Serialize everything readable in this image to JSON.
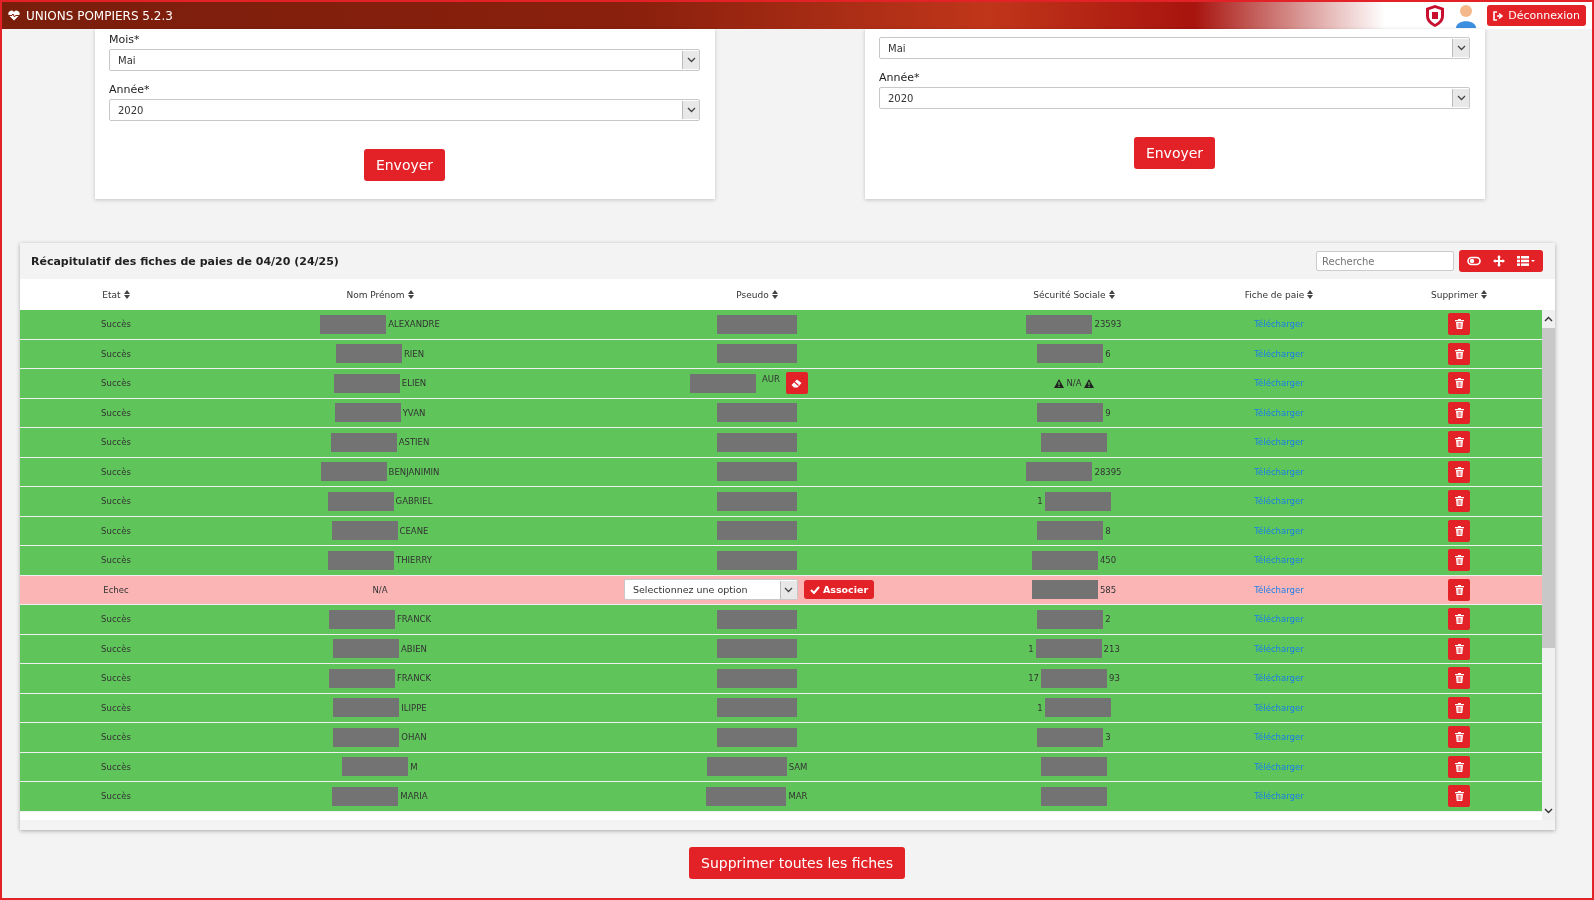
{
  "app": {
    "title": "UNIONS POMPIERS 5.2.3",
    "logout": "Déconnexion"
  },
  "forms": [
    {
      "fields": [
        {
          "label": "Mois*",
          "value": "Mai"
        },
        {
          "label": "Année*",
          "value": "2020"
        }
      ],
      "submit": "Envoyer"
    },
    {
      "fields": [
        {
          "value": "Mai"
        },
        {
          "label": "Année*",
          "value": "2020"
        }
      ],
      "submit": "Envoyer"
    }
  ],
  "summary": {
    "title": "Récapitulatif des fiches de paies de 04/20 (24/25)",
    "search": {
      "placeholder": "Recherche"
    },
    "columns": [
      "Etat",
      "Nom Prénom",
      "Pseudo",
      "Sécurité Sociale",
      "Fiche de paie",
      "Supprimer"
    ],
    "rows": [
      {
        "status": "Succès",
        "success": true,
        "name": {
          "redacted": true,
          "text": "ALEXANDRE"
        },
        "pseudo": {
          "kind": "text",
          "redacted": true
        },
        "ssn": {
          "kind": "text",
          "redacted": true,
          "text": "23593"
        },
        "payslip": "Télécharger"
      },
      {
        "status": "Succès",
        "success": true,
        "name": {
          "redacted": true,
          "text": "RIEN"
        },
        "pseudo": {
          "kind": "text",
          "redacted": true
        },
        "ssn": {
          "kind": "text",
          "redacted": true,
          "text": "6"
        },
        "payslip": "Télécharger"
      },
      {
        "status": "Succès",
        "success": true,
        "name": {
          "redacted": true,
          "text": "ELIEN"
        },
        "pseudo": {
          "kind": "edit",
          "redacted": true,
          "text": "AUR"
        },
        "ssn": {
          "kind": "missing",
          "text": "N/A"
        },
        "payslip": "Télécharger"
      },
      {
        "status": "Succès",
        "success": true,
        "name": {
          "redacted": true,
          "text": "YVAN"
        },
        "pseudo": {
          "kind": "text",
          "redacted": true
        },
        "ssn": {
          "kind": "text",
          "redacted": true,
          "text": "9"
        },
        "payslip": "Télécharger"
      },
      {
        "status": "Succès",
        "success": true,
        "name": {
          "redacted": true,
          "text": "ASTIEN"
        },
        "pseudo": {
          "kind": "text",
          "redacted": true
        },
        "ssn": {
          "kind": "text",
          "redacted": true
        },
        "payslip": "Télécharger"
      },
      {
        "status": "Succès",
        "success": true,
        "name": {
          "redacted": true,
          "text": "BENJANIMIN"
        },
        "pseudo": {
          "kind": "text",
          "redacted": true
        },
        "ssn": {
          "kind": "text",
          "redacted": true,
          "text": "28395"
        },
        "payslip": "Télécharger"
      },
      {
        "status": "Succès",
        "success": true,
        "name": {
          "redacted": true,
          "text": "GABRIEL"
        },
        "pseudo": {
          "kind": "text",
          "redacted": true
        },
        "ssn": {
          "kind": "text",
          "prefix": "1",
          "redacted": true
        },
        "payslip": "Télécharger"
      },
      {
        "status": "Succès",
        "success": true,
        "name": {
          "redacted": true,
          "text": "CEANE"
        },
        "pseudo": {
          "kind": "text",
          "redacted": true
        },
        "ssn": {
          "kind": "text",
          "redacted": true,
          "text": "8"
        },
        "payslip": "Télécharger"
      },
      {
        "status": "Succès",
        "success": true,
        "name": {
          "redacted": true,
          "text": "THIERRY"
        },
        "pseudo": {
          "kind": "text",
          "redacted": true
        },
        "ssn": {
          "kind": "text",
          "redacted": true,
          "text": "450"
        },
        "payslip": "Télécharger"
      },
      {
        "status": "Echec",
        "success": false,
        "name": {
          "text": "N/A"
        },
        "pseudo": {
          "kind": "select",
          "placeholder": "Selectionnez une option",
          "action": "Associer"
        },
        "ssn": {
          "kind": "text",
          "redacted": true,
          "text": "585"
        },
        "payslip": "Télécharger"
      },
      {
        "status": "Succès",
        "success": true,
        "name": {
          "redacted": true,
          "text": "FRANCK"
        },
        "pseudo": {
          "kind": "text",
          "redacted": true
        },
        "ssn": {
          "kind": "text",
          "redacted": true,
          "text": "2"
        },
        "payslip": "Télécharger"
      },
      {
        "status": "Succès",
        "success": true,
        "name": {
          "redacted": true,
          "text": "ABIEN"
        },
        "pseudo": {
          "kind": "text",
          "redacted": true
        },
        "ssn": {
          "kind": "text",
          "prefix": "1",
          "redacted": true,
          "text": "213"
        },
        "payslip": "Télécharger"
      },
      {
        "status": "Succès",
        "success": true,
        "name": {
          "redacted": true,
          "text": "FRANCK"
        },
        "pseudo": {
          "kind": "text",
          "redacted": true
        },
        "ssn": {
          "kind": "text",
          "prefix": "17",
          "redacted": true,
          "text": "93"
        },
        "payslip": "Télécharger"
      },
      {
        "status": "Succès",
        "success": true,
        "name": {
          "redacted": true,
          "text": "ILIPPE"
        },
        "pseudo": {
          "kind": "text",
          "redacted": true
        },
        "ssn": {
          "kind": "text",
          "prefix": "1",
          "redacted": true
        },
        "payslip": "Télécharger"
      },
      {
        "status": "Succès",
        "success": true,
        "name": {
          "redacted": true,
          "text": "OHAN"
        },
        "pseudo": {
          "kind": "text",
          "redacted": true
        },
        "ssn": {
          "kind": "text",
          "redacted": true,
          "text": "3"
        },
        "payslip": "Télécharger"
      },
      {
        "status": "Succès",
        "success": true,
        "name": {
          "redacted": true,
          "text": "M"
        },
        "pseudo": {
          "kind": "text",
          "redacted": true,
          "text": "SAM"
        },
        "ssn": {
          "kind": "text",
          "redacted": true
        },
        "payslip": "Télécharger"
      },
      {
        "status": "Succès",
        "success": true,
        "name": {
          "redacted": true,
          "text": "MARIA"
        },
        "pseudo": {
          "kind": "text",
          "redacted": true,
          "text": "MAR"
        },
        "ssn": {
          "kind": "text",
          "redacted": true
        },
        "payslip": "Télécharger"
      }
    ]
  },
  "delete_all": "Supprimer toutes les fiches"
}
